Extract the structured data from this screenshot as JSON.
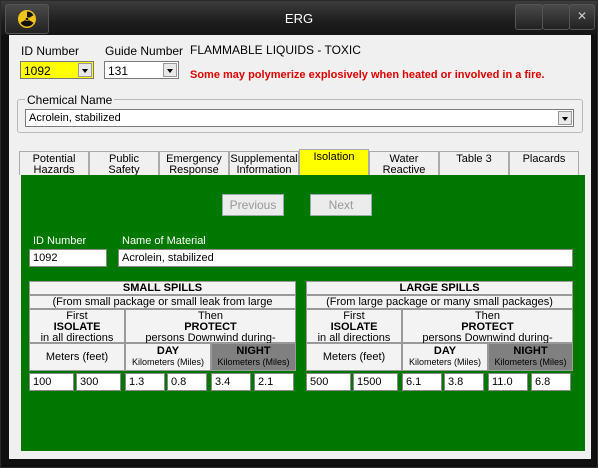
{
  "window": {
    "title": "ERG"
  },
  "id_number": {
    "label": "ID Number",
    "value": "1092"
  },
  "guide_number": {
    "label": "Guide Number",
    "value": "131"
  },
  "hazard_title": "FLAMMABLE LIQUIDS - TOXIC",
  "hazard_warning": "Some may polymerize explosively when heated or involved in a fire.",
  "chemical": {
    "label": "Chemical Name",
    "value": "Acrolein, stabilized"
  },
  "tabs": [
    {
      "line1": "Potential",
      "line2": "Hazards"
    },
    {
      "line1": "Public",
      "line2": "Safety"
    },
    {
      "line1": "Emergency",
      "line2": "Response"
    },
    {
      "line1": "Supplemental",
      "line2": "Information"
    },
    {
      "line1": "Isolation",
      "line2": ""
    },
    {
      "line1": "Water",
      "line2": "Reactive"
    },
    {
      "line1": "Table 3",
      "line2": ""
    },
    {
      "line1": "Placards",
      "line2": ""
    }
  ],
  "nav": {
    "previous": "Previous",
    "next": "Next"
  },
  "material": {
    "id_label": "ID Number",
    "id_value": "1092",
    "name_label": "Name of Material",
    "name_value": "Acrolein, stabilized"
  },
  "small": {
    "title": "SMALL SPILLS",
    "subtitle": "(From small package or small leak from large package)",
    "first": "First",
    "isolate": "ISOLATE",
    "all_dir": "in all directions",
    "then": "Then",
    "protect": "PROTECT",
    "downwind": "persons Downwind during-",
    "meters_label": "Meters (feet)",
    "day": "DAY",
    "night": "NIGHT",
    "km": "Kilometers (Miles)",
    "values": [
      "100",
      "300",
      "1.3",
      "0.8",
      "3.4",
      "2.1"
    ]
  },
  "large": {
    "title": "LARGE SPILLS",
    "subtitle": "(From large package or many small packages)",
    "first": "First",
    "isolate": "ISOLATE",
    "all_dir": "in all directions",
    "then": "Then",
    "protect": "PROTECT",
    "downwind": "persons Downwind during-",
    "meters_label": "Meters (feet)",
    "day": "DAY",
    "night": "NIGHT",
    "km": "Kilometers (Miles)",
    "values": [
      "500",
      "1500",
      "6.1",
      "3.8",
      "11.0",
      "6.8"
    ]
  }
}
